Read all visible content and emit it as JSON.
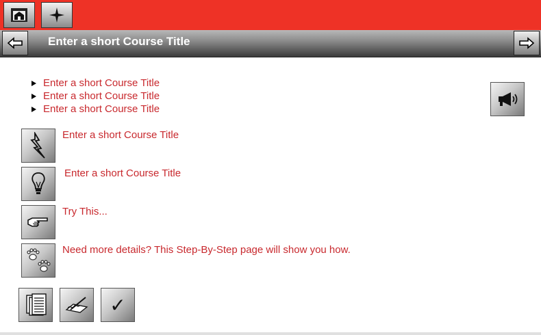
{
  "header": {
    "title": "Enter a short Course Title",
    "top_buttons": [
      {
        "icon": "home-icon"
      },
      {
        "icon": "compass-star-icon"
      }
    ],
    "nav": {
      "prev_icon": "back-arrow-icon",
      "next_icon": "forward-arrow-icon"
    }
  },
  "bullets": [
    "Enter a short Course Title",
    "Enter a short Course Title",
    "Enter a short Course Title"
  ],
  "audio_button": {
    "icon": "megaphone-icon"
  },
  "rows": [
    {
      "icon": "lightning-icon",
      "text": "Enter a short Course Title"
    },
    {
      "icon": "lightbulb-icon",
      "text": "Enter a short Course Title"
    },
    {
      "icon": "pointing-hand-icon",
      "text": "Try This..."
    },
    {
      "icon": "paw-prints-icon",
      "text": "Need more details? This Step-By-Step page will show you how."
    }
  ],
  "bottom_buttons": [
    {
      "icon": "documents-icon"
    },
    {
      "icon": "pen-write-icon"
    },
    {
      "icon": "checkmark-icon",
      "glyph": "✓"
    }
  ],
  "colors": {
    "topbar": "#ee3226",
    "text_accent": "#c8282d"
  }
}
